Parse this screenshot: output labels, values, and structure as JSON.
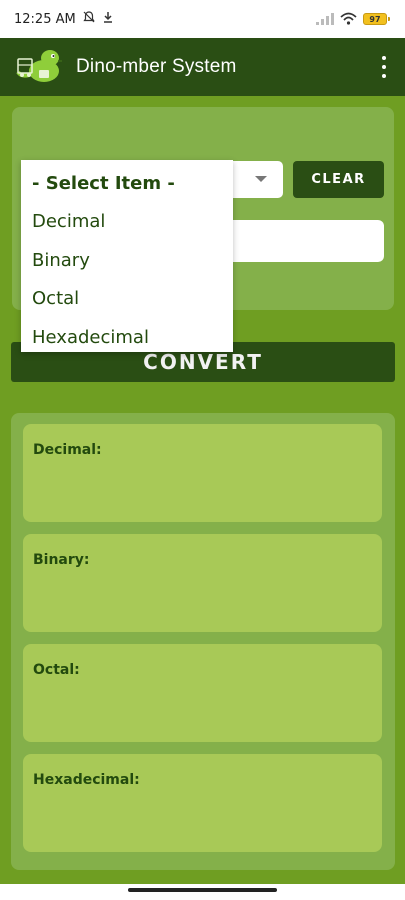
{
  "status_bar": {
    "time": "12:25 AM",
    "icons": [
      "bell-off-icon",
      "download-icon",
      "signal-icon",
      "wifi-icon"
    ],
    "battery": "97"
  },
  "app_bar": {
    "title": "Dino-mber System",
    "logo": "dinosaur-logo",
    "menu_icon": "more-vert-icon"
  },
  "input": {
    "clear_label": "CLEAR",
    "number_value": ""
  },
  "convert_label": "CONVERT",
  "dropdown": {
    "options": [
      "- Select Item -",
      "Decimal",
      "Binary",
      "Octal",
      "Hexadecimal"
    ]
  },
  "results": [
    {
      "label": "Decimal:",
      "value": ""
    },
    {
      "label": "Binary:",
      "value": ""
    },
    {
      "label": "Octal:",
      "value": ""
    },
    {
      "label": "Hexadecimal:",
      "value": ""
    }
  ],
  "colors": {
    "dark_green": "#2a4e14",
    "main_green": "#6f9e22",
    "card_green": "#84b04a",
    "box_green": "#a8c957",
    "text_green": "#234a0e"
  }
}
